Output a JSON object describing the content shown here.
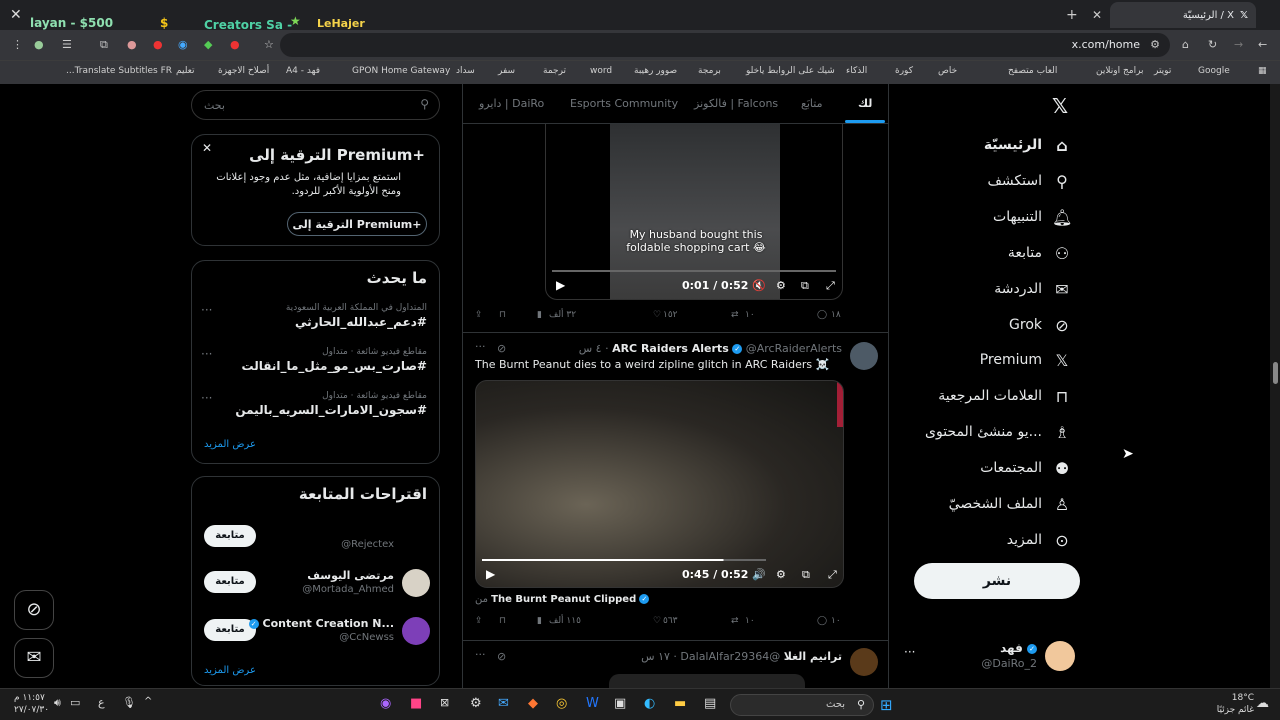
{
  "browser": {
    "tab_title": "الرئيسيّة / X",
    "url": "x.com/home",
    "ext_labels": [
      "layan - $500",
      "Creators Sa -",
      "LeHajer"
    ],
    "bookmarks": [
      "Google",
      "تويتر",
      "برامج اونلاين",
      "العاب متصفح",
      "خاص",
      "كورة",
      "الذكاء",
      "شيك على الروابط ياخلو",
      "برمجة",
      "صوور رهيبة",
      "word",
      "ترجمة",
      "سفر",
      "سداد",
      "GPON Home Gateway",
      "فهد - A4",
      "أصلاح الاجهزة",
      "تعليم",
      "Translate Subtitles FR..."
    ]
  },
  "search": {
    "placeholder": "بحث"
  },
  "premium": {
    "title": "الترقية إلى Premium+",
    "body": "استمتع بمزايا إضافية، مثل عدم وجود إعلانات ومنح الأولوية الأكبر للردود.",
    "button": "الترقية إلى Premium+"
  },
  "trends": {
    "title": "ما يحدث",
    "items": [
      {
        "meta": "المتداول في المملكة العربية السعودية",
        "tag": "#دعم_عبدالله_الحارثي"
      },
      {
        "meta": "مقاطع فيديو شائعة · متداول",
        "tag": "#صارت_بس_مو_مثل_ما_انقالت"
      },
      {
        "meta": "مقاطع فيديو شائعة · متداول",
        "tag": "#سجون_الامارات_السريه_باليمن"
      }
    ],
    "more": "عرض المزيد"
  },
  "follow": {
    "title": "اقتراحات المتابعة",
    "button": "متابعة",
    "items": [
      {
        "name": "",
        "handle": "@Rejectex"
      },
      {
        "name": "مرتضى اليوسف",
        "handle": "@Mortada_Ahmed"
      },
      {
        "name": "Content Creation N...",
        "handle": "@CcNewss"
      }
    ],
    "more": "عرض المزيد"
  },
  "feed_tabs": [
    "لك",
    "متابَع",
    "فالكونز | Falcons",
    "Esports Community",
    "دايرو | DaiRo"
  ],
  "post1": {
    "caption": "My husband bought this foldable shopping cart 😂",
    "time": "0:01 / 0:52",
    "replies": "١٨",
    "reposts": "١٠",
    "likes": "١٥٢",
    "views": "٣٢ ألف"
  },
  "post2": {
    "name": "ARC Raiders Alerts",
    "handle": "@ArcRaiderAlerts",
    "time": "٤ س",
    "text": "The Burnt Peanut dies to a weird zipline glitch in ARC Raiders ☠️",
    "video_time": "0:45 / 0:52",
    "from_label": "من",
    "from_name": "The Burnt Peanut Clipped",
    "replies": "١٠",
    "reposts": "١٠",
    "likes": "٥٦٣",
    "views": "١١٥ ألف"
  },
  "post3": {
    "name": "ترانيم الغلا",
    "handle": "@DalalAlfar29364",
    "time": "١٧ س"
  },
  "nav": [
    "الرئيسيّة",
    "استكشف",
    "التنبيهات",
    "متابعة",
    "الدردشة",
    "Grok",
    "Premium",
    "العلامات المرجعية",
    "يو منشئ المحتوى...",
    "المجتمعات",
    "الملف الشخصيّ",
    "المزيد"
  ],
  "post_button": "نشر",
  "me": {
    "name": "فهد",
    "handle": "@DaiRo_2"
  },
  "taskbar": {
    "search": "بحث",
    "time": "١١:٥٧ م",
    "date": "٢٧/٠٧/٣٠",
    "temp": "18°C",
    "weather": "غائم جزئيًا",
    "lang": "ع"
  }
}
